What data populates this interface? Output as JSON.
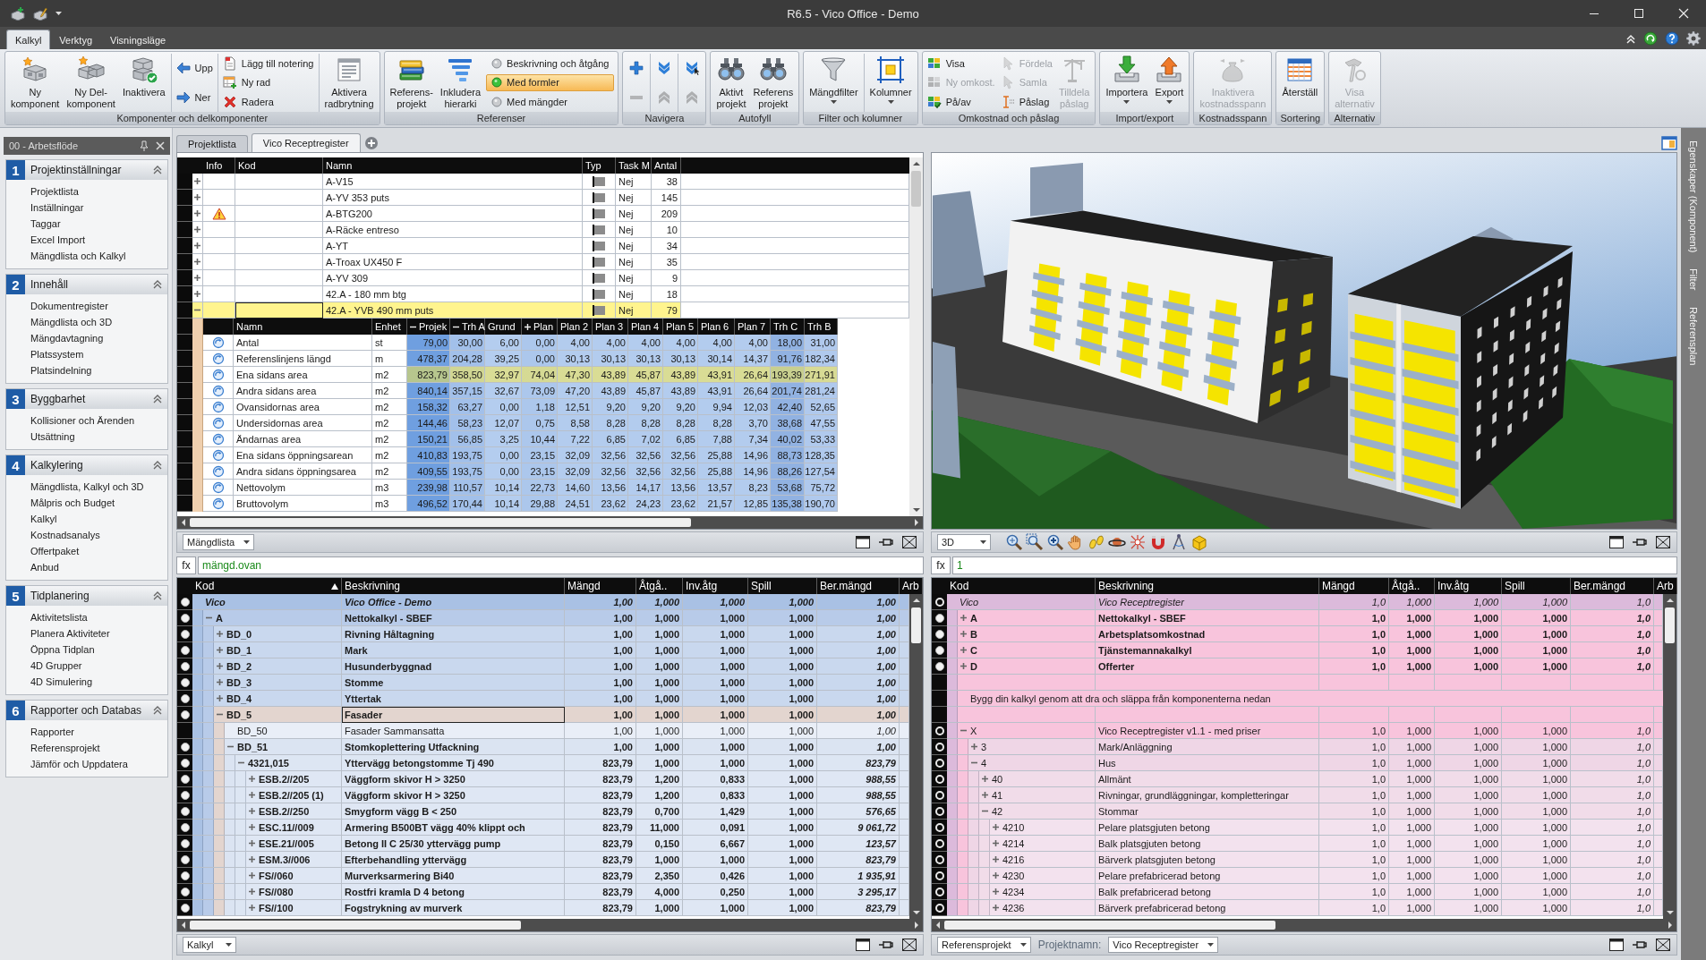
{
  "window": {
    "title": "R6.5 - Vico Office - Demo"
  },
  "ribbon": {
    "tabs": [
      {
        "label": "Kalkyl",
        "selected": true
      },
      {
        "label": "Verktyg",
        "selected": false
      },
      {
        "label": "Visningsläge",
        "selected": false
      }
    ],
    "groups": [
      {
        "label": "Komponenter och delkomponenter",
        "sections": [
          [
            {
              "kind": "large",
              "label": "Ny\nkomponent",
              "disabled": false,
              "dropdown": false
            },
            {
              "kind": "large",
              "label": "Ny Del-\nkomponent",
              "disabled": false,
              "dropdown": false
            },
            {
              "kind": "large",
              "label": "Inaktivera",
              "disabled": false,
              "dropdown": false
            }
          ],
          [
            {
              "kind": "stack",
              "items": [
                {
                  "label": "Upp",
                  "disabled": false
                },
                {
                  "label": "Ner",
                  "disabled": false
                }
              ]
            }
          ],
          [
            {
              "kind": "stack",
              "items": [
                {
                  "label": "Lägg till notering",
                  "disabled": false
                },
                {
                  "label": "Ny rad",
                  "disabled": false
                },
                {
                  "label": "Radera",
                  "disabled": false
                }
              ]
            }
          ],
          [
            {
              "kind": "large",
              "label": "Aktivera\nradbrytning",
              "disabled": false,
              "dropdown": false
            }
          ]
        ]
      },
      {
        "label": "Referenser",
        "sections": [
          [
            {
              "kind": "large",
              "label": "Referens-\nprojekt",
              "disabled": false,
              "dropdown": false
            },
            {
              "kind": "large",
              "label": "Inkludera\nhierarki",
              "disabled": false,
              "dropdown": false
            },
            {
              "kind": "radios",
              "items": [
                {
                  "label": "Beskrivning och åtgång",
                  "selected": false
                },
                {
                  "label": "Med formler",
                  "selected": true
                },
                {
                  "label": "Med mängder",
                  "selected": false
                }
              ]
            }
          ]
        ]
      },
      {
        "label": "Navigera",
        "sections": [
          [
            {
              "kind": "icons",
              "items": [
                {
                  "disabled": false
                },
                {
                  "disabled": true
                }
              ]
            }
          ],
          [
            {
              "kind": "icons",
              "items": [
                {
                  "disabled": false
                },
                {
                  "disabled": true
                }
              ]
            }
          ],
          [
            {
              "kind": "icons",
              "items": [
                {
                  "disabled": false
                },
                {
                  "disabled": true
                }
              ]
            }
          ]
        ]
      },
      {
        "label": "Autofyll",
        "sections": [
          [
            {
              "kind": "large",
              "label": "Aktivt\nprojekt",
              "disabled": false,
              "dropdown": false
            },
            {
              "kind": "large",
              "label": "Referens\nprojekt",
              "disabled": false,
              "dropdown": false
            }
          ]
        ]
      },
      {
        "label": "Filter och kolumner",
        "sections": [
          [
            {
              "kind": "large",
              "label": "Mängdfilter",
              "disabled": false,
              "dropdown": true
            }
          ],
          [
            {
              "kind": "large",
              "label": "Kolumner",
              "disabled": false,
              "dropdown": true
            }
          ]
        ]
      },
      {
        "label": "Omkostnad och påslag",
        "sections": [
          [
            {
              "kind": "stack",
              "items": [
                {
                  "label": "Visa",
                  "disabled": false
                },
                {
                  "label": "Ny omkost.",
                  "disabled": true
                },
                {
                  "label": "På/av",
                  "disabled": false
                }
              ]
            },
            {
              "kind": "stack",
              "items": [
                {
                  "label": "Fördela",
                  "disabled": true
                },
                {
                  "label": "Samla",
                  "disabled": true
                },
                {
                  "label": "Påslag",
                  "disabled": false
                }
              ]
            },
            {
              "kind": "large",
              "label": "Tilldela\npåslag",
              "disabled": true,
              "dropdown": false
            }
          ]
        ]
      },
      {
        "label": "Import/export",
        "sections": [
          [
            {
              "kind": "large",
              "label": "Importera",
              "disabled": false,
              "dropdown": true
            },
            {
              "kind": "large",
              "label": "Export",
              "disabled": false,
              "dropdown": true
            }
          ]
        ]
      },
      {
        "label": "Kostnadsspann",
        "sections": [
          [
            {
              "kind": "large",
              "label": "Inaktivera\nkostnadsspann",
              "disabled": true,
              "dropdown": false
            }
          ]
        ]
      },
      {
        "label": "Sortering",
        "sections": [
          [
            {
              "kind": "large",
              "label": "Återställ",
              "disabled": false,
              "dropdown": false
            }
          ]
        ]
      },
      {
        "label": "Alternativ",
        "sections": [
          [
            {
              "kind": "large",
              "label": "Visa\nalternativ",
              "disabled": true,
              "dropdown": false
            }
          ]
        ]
      }
    ]
  },
  "sidebar": {
    "title": "00 - Arbetsflöde",
    "sections": [
      {
        "number": "1",
        "title": "Projektinställningar",
        "items": [
          "Projektlista",
          "Inställningar",
          "Taggar",
          "Excel Import",
          "Mängdlista och Kalkyl"
        ]
      },
      {
        "number": "2",
        "title": "Innehåll",
        "items": [
          "Dokumentregister",
          "Mängdlista och 3D",
          "Mängdavtagning",
          "Platssystem",
          "Platsindelning"
        ]
      },
      {
        "number": "3",
        "title": "Byggbarhet",
        "items": [
          "Kollisioner och Ärenden",
          "Utsättning"
        ]
      },
      {
        "number": "4",
        "title": "Kalkylering",
        "items": [
          "Mängdlista, Kalkyl och 3D",
          "Målpris och Budget",
          "Kalkyl",
          "Kostnadsanalys",
          "Offertpaket",
          "Anbud"
        ]
      },
      {
        "number": "5",
        "title": "Tidplanering",
        "items": [
          "Aktivitetslista",
          "Planera Aktiviteter",
          "Öppna Tidplan",
          "4D Grupper",
          "4D Simulering"
        ]
      },
      {
        "number": "6",
        "title": "Rapporter och Databas",
        "items": [
          "Rapporter",
          "Referensprojekt",
          "Jämför och Uppdatera"
        ]
      }
    ]
  },
  "document_tabs": [
    {
      "label": "Projektlista",
      "selected": false
    },
    {
      "label": "Vico Receptregister",
      "selected": true
    }
  ],
  "component_pane": {
    "columns": [
      "Info",
      "Kod",
      "Namn",
      "Typ",
      "Task M",
      "Antal"
    ],
    "rows": [
      {
        "namn": "A-V15",
        "task": "Nej",
        "antal": "38",
        "warning": false,
        "expanded": false,
        "selected": false
      },
      {
        "namn": "A-YV 353 puts",
        "task": "Nej",
        "antal": "145",
        "warning": false,
        "expanded": false,
        "selected": false
      },
      {
        "namn": "A-BTG200",
        "task": "Nej",
        "antal": "209",
        "warning": true,
        "expanded": false,
        "selected": false
      },
      {
        "namn": "A-Räcke entreso",
        "task": "Nej",
        "antal": "10",
        "warning": false,
        "expanded": false,
        "selected": false
      },
      {
        "namn": "A-YT",
        "task": "Nej",
        "antal": "34",
        "warning": false,
        "expanded": false,
        "selected": false
      },
      {
        "namn": "A-Troax UX450 F",
        "task": "Nej",
        "antal": "35",
        "warning": false,
        "expanded": false,
        "selected": false
      },
      {
        "namn": "A-YV 309",
        "task": "Nej",
        "antal": "9",
        "warning": false,
        "expanded": false,
        "selected": false
      },
      {
        "namn": "42.A - 180 mm btg",
        "task": "Nej",
        "antal": "18",
        "warning": false,
        "expanded": false,
        "selected": false
      },
      {
        "namn": "42.A - YVB 490 mm puts",
        "task": "Nej",
        "antal": "79",
        "warning": false,
        "expanded": true,
        "selected": true,
        "quantities": {
          "columns": [
            {
              "label": "Namn",
              "kind": "text"
            },
            {
              "label": "Enhet",
              "kind": "text"
            },
            {
              "label": "Projek",
              "kind": "open-group",
              "color": "#6f9fe0"
            },
            {
              "label": "Trh A",
              "kind": "open-group",
              "color": "#a2c0ea"
            },
            {
              "label": "Grund",
              "kind": "value",
              "color": "#b4cdef"
            },
            {
              "label": "Plan",
              "kind": "closed-group",
              "color": "#acc7ec"
            },
            {
              "label": "Plan 2",
              "kind": "value",
              "color": "#b3ccee"
            },
            {
              "label": "Plan 3",
              "kind": "value",
              "color": "#b3ccee"
            },
            {
              "label": "Plan 4",
              "kind": "value",
              "color": "#b3ccee"
            },
            {
              "label": "Plan 5",
              "kind": "value",
              "color": "#b3ccee"
            },
            {
              "label": "Plan 6",
              "kind": "value",
              "color": "#b3ccee"
            },
            {
              "label": "Plan 7",
              "kind": "value",
              "color": "#b3ccee"
            },
            {
              "label": "Trh C",
              "kind": "value",
              "color": "#91b2e2"
            },
            {
              "label": "Trh B",
              "kind": "value",
              "color": "#b0c9ed"
            }
          ],
          "rows": [
            {
              "namn": "Antal",
              "enhet": "st",
              "values": [
                "79,00",
                "30,00",
                "6,00",
                "0,00",
                "4,00",
                "4,00",
                "4,00",
                "4,00",
                "4,00",
                "4,00",
                "18,00",
                "31,00"
              ],
              "selected": false
            },
            {
              "namn": "Referenslinjens längd",
              "enhet": "m",
              "values": [
                "478,37",
                "204,28",
                "39,25",
                "0,00",
                "30,13",
                "30,13",
                "30,13",
                "30,13",
                "30,14",
                "14,37",
                "91,76",
                "182,34"
              ],
              "selected": false
            },
            {
              "namn": "Ena sidans area",
              "enhet": "m2",
              "values": [
                "823,79",
                "358,50",
                "32,97",
                "74,04",
                "47,30",
                "43,89",
                "45,87",
                "43,89",
                "43,91",
                "26,64",
                "193,39",
                "271,91"
              ],
              "selected": true
            },
            {
              "namn": "Andra sidans area",
              "enhet": "m2",
              "values": [
                "840,14",
                "357,15",
                "32,67",
                "73,09",
                "47,20",
                "43,89",
                "45,87",
                "43,89",
                "43,91",
                "26,64",
                "201,74",
                "281,24"
              ],
              "selected": false
            },
            {
              "namn": "Ovansidornas area",
              "enhet": "m2",
              "values": [
                "158,32",
                "63,27",
                "0,00",
                "1,18",
                "12,51",
                "9,20",
                "9,20",
                "9,20",
                "9,94",
                "12,03",
                "42,40",
                "52,65"
              ],
              "selected": false
            },
            {
              "namn": "Undersidornas area",
              "enhet": "m2",
              "values": [
                "144,46",
                "58,23",
                "12,07",
                "0,75",
                "8,58",
                "8,28",
                "8,28",
                "8,28",
                "8,28",
                "3,70",
                "38,68",
                "47,55"
              ],
              "selected": false
            },
            {
              "namn": "Ändarnas area",
              "enhet": "m2",
              "values": [
                "150,21",
                "56,85",
                "3,25",
                "10,44",
                "7,22",
                "6,85",
                "7,02",
                "6,85",
                "7,88",
                "7,34",
                "40,02",
                "53,33"
              ],
              "selected": false
            },
            {
              "namn": "Ena sidans öppningsarean",
              "enhet": "m2",
              "values": [
                "410,83",
                "193,75",
                "0,00",
                "23,15",
                "32,09",
                "32,56",
                "32,56",
                "32,56",
                "25,88",
                "14,96",
                "88,73",
                "128,35"
              ],
              "selected": false
            },
            {
              "namn": "Andra sidans öppningsarea",
              "enhet": "m2",
              "values": [
                "409,55",
                "193,75",
                "0,00",
                "23,15",
                "32,09",
                "32,56",
                "32,56",
                "32,56",
                "25,88",
                "14,96",
                "88,26",
                "127,54"
              ],
              "selected": false
            },
            {
              "namn": "Nettovolym",
              "enhet": "m3",
              "values": [
                "239,98",
                "110,57",
                "10,14",
                "22,73",
                "14,60",
                "13,56",
                "14,17",
                "13,56",
                "13,57",
                "8,23",
                "53,68",
                "75,72"
              ],
              "selected": false
            },
            {
              "namn": "Bruttovolym",
              "enhet": "m3",
              "values": [
                "496,52",
                "170,44",
                "10,14",
                "29,88",
                "24,51",
                "23,62",
                "24,23",
                "23,62",
                "21,57",
                "12,85",
                "135,38",
                "190,70"
              ],
              "selected": false
            }
          ]
        }
      }
    ],
    "footer": {
      "selector": "Mängdlista"
    }
  },
  "model_pane": {
    "footer": {
      "selector": "3D"
    }
  },
  "calculation_pane": {
    "formula": {
      "label": "fx",
      "value": "mängd.ovan"
    },
    "columns": [
      {
        "label": "Kod",
        "sorted": true
      },
      {
        "label": "Beskrivning",
        "sorted": false
      },
      {
        "label": "Mängd",
        "sorted": false
      },
      {
        "label": "Åtgå..",
        "sorted": false
      },
      {
        "label": "Inv.åtg",
        "sorted": false
      },
      {
        "label": "Spill",
        "sorted": false
      },
      {
        "label": "Ber.mängd",
        "sorted": false
      },
      {
        "label": "Arb",
        "sorted": false
      }
    ],
    "rows": [
      {
        "kind": "summary",
        "kod": "Vico",
        "beskrivning": "Vico Office - Demo",
        "values": [
          "1,00",
          "1,000",
          "1,000",
          "1,000",
          "1,00"
        ],
        "filled": true,
        "selected": false,
        "children": [
          {
            "kind": "group",
            "kod": "A",
            "beskrivning": "Nettokalkyl - SBEF",
            "values": [
              "1,00",
              "1,000",
              "1,000",
              "1,000",
              "1,00"
            ],
            "filled": true,
            "expanded": true,
            "selected": false,
            "children": [
              {
                "kind": "group",
                "kod": "BD_0",
                "beskrivning": "Rivning Håltagning",
                "values": [
                  "1,00",
                  "1,000",
                  "1,000",
                  "1,000",
                  "1,00"
                ],
                "filled": true,
                "expanded": false,
                "selected": false
              },
              {
                "kind": "group",
                "kod": "BD_1",
                "beskrivning": "Mark",
                "values": [
                  "1,00",
                  "1,000",
                  "1,000",
                  "1,000",
                  "1,00"
                ],
                "filled": true,
                "expanded": false,
                "selected": false
              },
              {
                "kind": "group",
                "kod": "BD_2",
                "beskrivning": "Husunderbyggnad",
                "values": [
                  "1,00",
                  "1,000",
                  "1,000",
                  "1,000",
                  "1,00"
                ],
                "filled": true,
                "expanded": false,
                "selected": false
              },
              {
                "kind": "group",
                "kod": "BD_3",
                "beskrivning": "Stomme",
                "values": [
                  "1,00",
                  "1,000",
                  "1,000",
                  "1,000",
                  "1,00"
                ],
                "filled": true,
                "expanded": false,
                "selected": false
              },
              {
                "kind": "group",
                "kod": "BD_4",
                "beskrivning": "Yttertak",
                "values": [
                  "1,00",
                  "1,000",
                  "1,000",
                  "1,000",
                  "1,00"
                ],
                "filled": true,
                "expanded": false,
                "selected": false
              },
              {
                "kind": "group",
                "kod": "BD_5",
                "beskrivning": "Fasader",
                "values": [
                  "1,00",
                  "1,000",
                  "1,000",
                  "1,000",
                  "1,00"
                ],
                "filled": true,
                "expanded": true,
                "selected": true,
                "children": [
                  {
                    "kind": "item",
                    "kod": "BD_50",
                    "beskrivning": "Fasader Sammansatta",
                    "values": [
                      "1,00",
                      "1,000",
                      "1,000",
                      "1,000",
                      "1,00"
                    ],
                    "selected": false
                  },
                  {
                    "kind": "group",
                    "kod": "BD_51",
                    "beskrivning": "Stomkoplettering Utfackning",
                    "values": [
                      "1,00",
                      "1,000",
                      "1,000",
                      "1,000",
                      "1,00"
                    ],
                    "filled": true,
                    "expanded": true,
                    "selected": false,
                    "children": [
                      {
                        "kind": "group",
                        "kod": "4321,015",
                        "beskrivning": "Yttervägg betongstomme Tj 490",
                        "values": [
                          "823,79",
                          "1,000",
                          "1,000",
                          "1,000",
                          "823,79"
                        ],
                        "filled": true,
                        "expanded": true,
                        "selected": false,
                        "children": [
                          {
                            "kind": "group",
                            "kod": "ESB.2//205",
                            "beskrivning": "Väggform skivor H > 3250",
                            "values": [
                              "823,79",
                              "1,200",
                              "0,833",
                              "1,000",
                              "988,55"
                            ],
                            "filled": true,
                            "expanded": false,
                            "selected": false
                          },
                          {
                            "kind": "group",
                            "kod": "ESB.2//205 (1)",
                            "beskrivning": "Väggform skivor H > 3250",
                            "values": [
                              "823,79",
                              "1,200",
                              "0,833",
                              "1,000",
                              "988,55"
                            ],
                            "filled": true,
                            "expanded": false,
                            "selected": false
                          },
                          {
                            "kind": "group",
                            "kod": "ESB.2//250",
                            "beskrivning": "Smygform vägg B < 250",
                            "values": [
                              "823,79",
                              "0,700",
                              "1,429",
                              "1,000",
                              "576,65"
                            ],
                            "filled": true,
                            "expanded": false,
                            "selected": false
                          },
                          {
                            "kind": "group",
                            "kod": "ESC.11//009",
                            "beskrivning": "Armering B500BT vägg 40% klippt och",
                            "values": [
                              "823,79",
                              "11,000",
                              "0,091",
                              "1,000",
                              "9 061,72"
                            ],
                            "filled": true,
                            "expanded": false,
                            "selected": false
                          },
                          {
                            "kind": "group",
                            "kod": "ESE.21//005",
                            "beskrivning": "Betong II C 25/30 yttervägg pump",
                            "values": [
                              "823,79",
                              "0,150",
                              "6,667",
                              "1,000",
                              "123,57"
                            ],
                            "filled": true,
                            "expanded": false,
                            "selected": false
                          },
                          {
                            "kind": "group",
                            "kod": "ESM.3//006",
                            "beskrivning": "Efterbehandling yttervägg",
                            "values": [
                              "823,79",
                              "1,000",
                              "1,000",
                              "1,000",
                              "823,79"
                            ],
                            "filled": true,
                            "expanded": false,
                            "selected": false
                          },
                          {
                            "kind": "group",
                            "kod": "FS//060",
                            "beskrivning": "Murverksarmering Bi40",
                            "values": [
                              "823,79",
                              "2,350",
                              "0,426",
                              "1,000",
                              "1 935,91"
                            ],
                            "filled": true,
                            "expanded": false,
                            "selected": false
                          },
                          {
                            "kind": "group",
                            "kod": "FS//080",
                            "beskrivning": "Rostfri kramla D 4 betong",
                            "values": [
                              "823,79",
                              "4,000",
                              "0,250",
                              "1,000",
                              "3 295,17"
                            ],
                            "filled": true,
                            "expanded": false,
                            "selected": false
                          },
                          {
                            "kind": "group",
                            "kod": "FS//100",
                            "beskrivning": "Fogstrykning av murverk",
                            "values": [
                              "823,79",
                              "1,000",
                              "1,000",
                              "1,000",
                              "823,79"
                            ],
                            "filled": true,
                            "expanded": false,
                            "selected": false
                          }
                        ]
                      }
                    ]
                  }
                ]
              }
            ]
          }
        ]
      }
    ],
    "footer": {
      "selector": "Kalkyl"
    }
  },
  "reference_pane": {
    "formula": {
      "label": "fx",
      "value": "1"
    },
    "columns": [
      {
        "label": "Kod",
        "sorted": false
      },
      {
        "label": "Beskrivning",
        "sorted": false
      },
      {
        "label": "Mängd",
        "sorted": false
      },
      {
        "label": "Åtgå..",
        "sorted": false
      },
      {
        "label": "Inv.åtg",
        "sorted": false
      },
      {
        "label": "Spill",
        "sorted": false
      },
      {
        "label": "Ber.mängd",
        "sorted": false
      },
      {
        "label": "Arb",
        "sorted": false
      }
    ],
    "rows": [
      {
        "kind": "root",
        "kod": "Vico",
        "beskrivning": "Vico Receptregister",
        "values": [
          "1,0",
          "1,000",
          "1,000",
          "1,000",
          "1,0"
        ],
        "filled": false,
        "selected": false,
        "children": [
          {
            "kind": "group",
            "kod": "A",
            "beskrivning": "Nettokalkyl - SBEF",
            "values": [
              "1,0",
              "1,000",
              "1,000",
              "1,000",
              "1,0"
            ],
            "filled": true,
            "expanded": false,
            "selected": false
          },
          {
            "kind": "group",
            "kod": "B",
            "beskrivning": "Arbetsplatsomkostnad",
            "values": [
              "1,0",
              "1,000",
              "1,000",
              "1,000",
              "1,0"
            ],
            "filled": true,
            "expanded": false,
            "selected": false
          },
          {
            "kind": "group",
            "kod": "C",
            "beskrivning": "Tjänstemannakalkyl",
            "values": [
              "1,0",
              "1,000",
              "1,000",
              "1,000",
              "1,0"
            ],
            "filled": true,
            "expanded": false,
            "selected": false
          },
          {
            "kind": "group",
            "kod": "D",
            "beskrivning": "Offerter",
            "values": [
              "1,0",
              "1,000",
              "1,000",
              "1,000",
              "1,0"
            ],
            "filled": true,
            "expanded": false,
            "selected": false
          },
          {
            "kind": "blank"
          },
          {
            "kind": "note",
            "text": "Bygg din kalkyl genom att dra och släppa från komponenterna nedan"
          },
          {
            "kind": "blank"
          },
          {
            "kind": "item",
            "kod": "X",
            "beskrivning": "Vico Receptregister v1.1 - med priser",
            "values": [
              "1,0",
              "1,000",
              "1,000",
              "1,000",
              "1,0"
            ],
            "filled": false,
            "expanded": true,
            "selected": false,
            "children": [
              {
                "kind": "item",
                "kod": "3",
                "beskrivning": "Mark/Anläggning",
                "values": [
                  "1,0",
                  "1,000",
                  "1,000",
                  "1,000",
                  "1,0"
                ],
                "filled": false,
                "expanded": false,
                "selected": false
              },
              {
                "kind": "item",
                "kod": "4",
                "beskrivning": "Hus",
                "values": [
                  "1,0",
                  "1,000",
                  "1,000",
                  "1,000",
                  "1,0"
                ],
                "filled": false,
                "expanded": true,
                "selected": false,
                "children": [
                  {
                    "kind": "item",
                    "kod": "40",
                    "beskrivning": "Allmänt",
                    "values": [
                      "1,0",
                      "1,000",
                      "1,000",
                      "1,000",
                      "1,0"
                    ],
                    "filled": false,
                    "expanded": false,
                    "selected": false
                  },
                  {
                    "kind": "item",
                    "kod": "41",
                    "beskrivning": "Rivningar, grundläggningar, kompletteringar",
                    "values": [
                      "1,0",
                      "1,000",
                      "1,000",
                      "1,000",
                      "1,0"
                    ],
                    "filled": false,
                    "expanded": false,
                    "selected": false
                  },
                  {
                    "kind": "item",
                    "kod": "42",
                    "beskrivning": "Stommar",
                    "values": [
                      "1,0",
                      "1,000",
                      "1,000",
                      "1,000",
                      "1,0"
                    ],
                    "filled": false,
                    "expanded": true,
                    "selected": false,
                    "children": [
                      {
                        "kind": "item",
                        "kod": "4210",
                        "beskrivning": "Pelare platsgjuten betong",
                        "values": [
                          "1,0",
                          "1,000",
                          "1,000",
                          "1,000",
                          "1,0"
                        ],
                        "filled": false,
                        "expanded": false,
                        "selected": false
                      },
                      {
                        "kind": "item",
                        "kod": "4214",
                        "beskrivning": "Balk platsgjuten betong",
                        "values": [
                          "1,0",
                          "1,000",
                          "1,000",
                          "1,000",
                          "1,0"
                        ],
                        "filled": false,
                        "expanded": false,
                        "selected": false
                      },
                      {
                        "kind": "item",
                        "kod": "4216",
                        "beskrivning": "Bärverk platsgjuten betong",
                        "values": [
                          "1,0",
                          "1,000",
                          "1,000",
                          "1,000",
                          "1,0"
                        ],
                        "filled": false,
                        "expanded": false,
                        "selected": false
                      },
                      {
                        "kind": "item",
                        "kod": "4230",
                        "beskrivning": "Pelare prefabricerad betong",
                        "values": [
                          "1,0",
                          "1,000",
                          "1,000",
                          "1,000",
                          "1,0"
                        ],
                        "filled": false,
                        "expanded": false,
                        "selected": false
                      },
                      {
                        "kind": "item",
                        "kod": "4234",
                        "beskrivning": "Balk prefabricerad betong",
                        "values": [
                          "1,0",
                          "1,000",
                          "1,000",
                          "1,000",
                          "1,0"
                        ],
                        "filled": false,
                        "expanded": false,
                        "selected": false
                      },
                      {
                        "kind": "item",
                        "kod": "4236",
                        "beskrivning": "Bärverk prefabricerad betong",
                        "values": [
                          "1,0",
                          "1,000",
                          "1,000",
                          "1,000",
                          "1,0"
                        ],
                        "filled": false,
                        "expanded": false,
                        "selected": false
                      }
                    ]
                  }
                ]
              }
            ]
          }
        ]
      }
    ],
    "footer": {
      "selector": "Referensprojekt",
      "project_label": "Projektnamn:",
      "project": "Vico Receptregister"
    }
  },
  "side_tabs": [
    "Egenskaper (Komponent)",
    "Filter",
    "Referensplan"
  ]
}
